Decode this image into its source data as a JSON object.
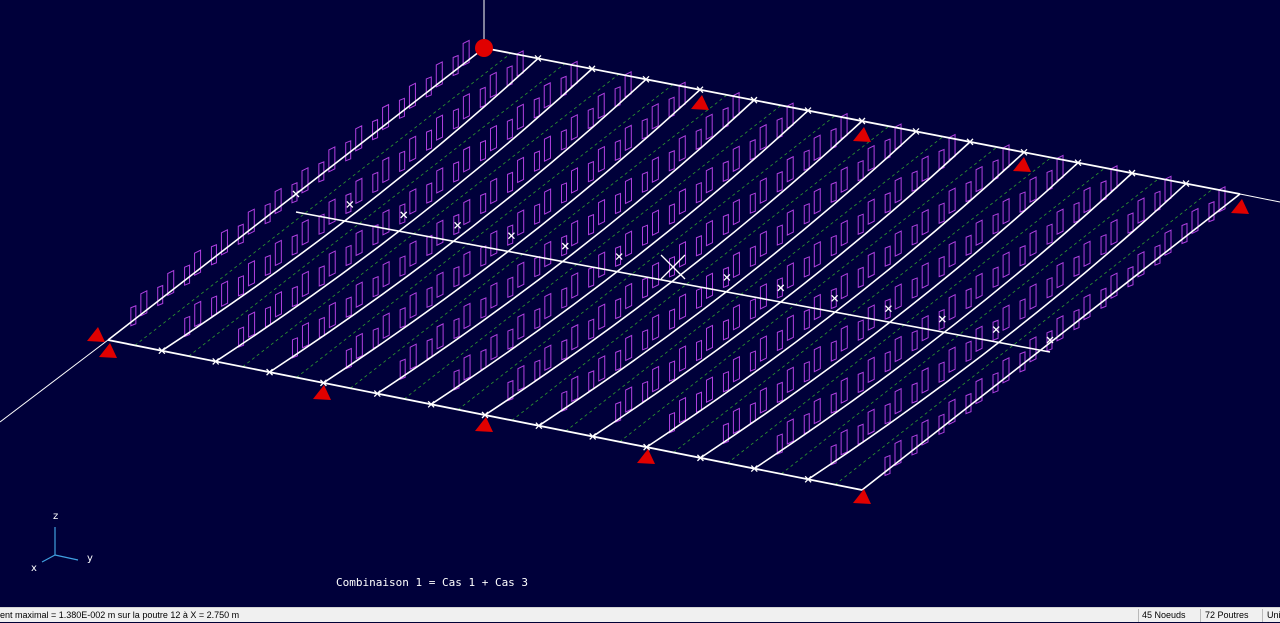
{
  "viewport": {
    "caption": "Combinaison 1 = Cas 1 + Cas 3",
    "axes": {
      "z": "z",
      "y": "y",
      "x": "x"
    },
    "colors": {
      "background": "#00003a",
      "beam": "#ffffff",
      "diagram": "#b040e0",
      "dashed": "#2e9b2e",
      "support": "#e00000",
      "axis": "#ffffff"
    }
  },
  "statusbar": {
    "message": "ent maximal = 1.380E-002 m sur la poutre 12 à X = 2.750 m",
    "nodes": "45 Noeuds",
    "beams": "72 Poutres",
    "units": "Uni"
  }
}
